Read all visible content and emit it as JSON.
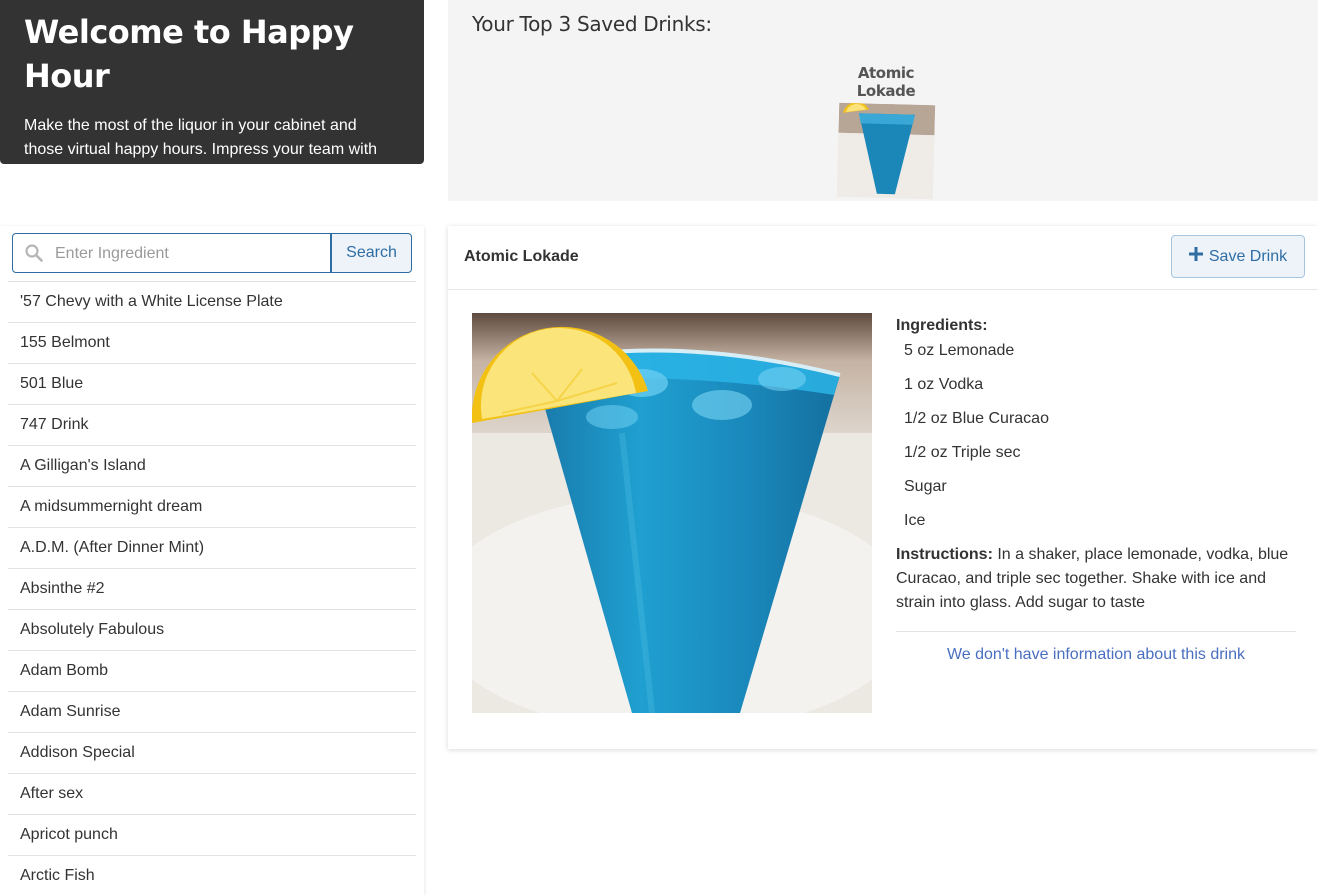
{
  "hero": {
    "title": "Welcome to Happy Hour",
    "text": "Make the most of the liquor in your cabinet and those virtual happy hours. Impress your team with information about your newfound cocktail."
  },
  "top_saved": {
    "heading": "Your Top 3 Saved Drinks:",
    "items": [
      {
        "name": "Atomic Lokade"
      }
    ]
  },
  "search": {
    "placeholder": "Enter Ingredient",
    "value": "",
    "button_label": "Search",
    "icon": "search-icon"
  },
  "drink_list": [
    "'57 Chevy with a White License Plate",
    "155 Belmont",
    "501 Blue",
    "747 Drink",
    "A Gilligan's Island",
    "A midsummernight dream",
    "A.D.M. (After Dinner Mint)",
    "Absinthe #2",
    "Absolutely Fabulous",
    "Adam Bomb",
    "Adam Sunrise",
    "Addison Special",
    "After sex",
    "Apricot punch",
    "Arctic Fish"
  ],
  "detail": {
    "name": "Atomic Lokade",
    "save_label": "Save Drink",
    "save_icon": "plus-icon",
    "ingredients_label": "Ingredients:",
    "ingredients": [
      "5 oz Lemonade",
      "1 oz Vodka",
      "1/2 oz Blue Curacao",
      "1/2 oz Triple sec",
      "Sugar",
      "Ice"
    ],
    "instructions_label": "Instructions:",
    "instructions": "In a shaker, place lemonade, vodka, blue Curacao, and triple sec together. Shake with ice and strain into glass. Add sugar to taste",
    "no_info_text": "We don't have information about this drink"
  },
  "colors": {
    "hero_bg": "#333333",
    "accent": "#2e6da4",
    "link": "#4a6fc0",
    "drink_blue": "#1e8fc0"
  }
}
